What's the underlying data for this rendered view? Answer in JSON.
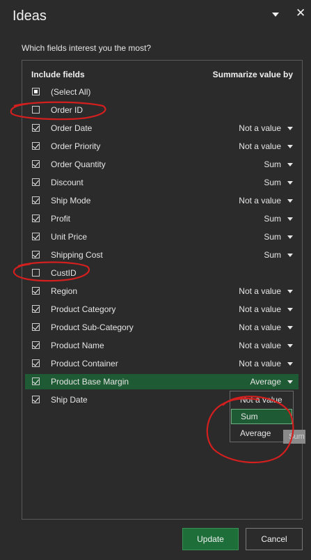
{
  "pane": {
    "title": "Ideas",
    "close_glyph": "✕"
  },
  "prompt": "Which fields interest you the most?",
  "headers": {
    "include": "Include fields",
    "summarize": "Summarize value by"
  },
  "fields": [
    {
      "name": "(Select All)",
      "state": "partial",
      "summarize": ""
    },
    {
      "name": "Order ID",
      "state": "unchecked",
      "summarize": ""
    },
    {
      "name": "Order Date",
      "state": "checked",
      "summarize": "Not a value"
    },
    {
      "name": "Order Priority",
      "state": "checked",
      "summarize": "Not a value"
    },
    {
      "name": "Order Quantity",
      "state": "checked",
      "summarize": "Sum"
    },
    {
      "name": "Discount",
      "state": "checked",
      "summarize": "Sum"
    },
    {
      "name": "Ship Mode",
      "state": "checked",
      "summarize": "Not a value"
    },
    {
      "name": "Profit",
      "state": "checked",
      "summarize": "Sum"
    },
    {
      "name": "Unit Price",
      "state": "checked",
      "summarize": "Sum"
    },
    {
      "name": "Shipping Cost",
      "state": "checked",
      "summarize": "Sum"
    },
    {
      "name": "CustID",
      "state": "unchecked",
      "summarize": ""
    },
    {
      "name": "Region",
      "state": "checked",
      "summarize": "Not a value"
    },
    {
      "name": "Product Category",
      "state": "checked",
      "summarize": "Not a value"
    },
    {
      "name": "Product Sub-Category",
      "state": "checked",
      "summarize": "Not a value"
    },
    {
      "name": "Product Name",
      "state": "checked",
      "summarize": "Not a value"
    },
    {
      "name": "Product Container",
      "state": "checked",
      "summarize": "Not a value"
    },
    {
      "name": "Product Base Margin",
      "state": "checked",
      "summarize": "Average",
      "selected": true
    },
    {
      "name": "Ship Date",
      "state": "checked",
      "summarize": ""
    }
  ],
  "dropdown": {
    "options": [
      "Not a value",
      "Sum",
      "Average"
    ],
    "highlighted": "Sum"
  },
  "tooltip": "Sum",
  "buttons": {
    "update": "Update",
    "cancel": "Cancel"
  },
  "colors": {
    "background": "#2b2b2b",
    "accent_green": "#1e5a33",
    "annotation_red": "#d41f1f"
  }
}
